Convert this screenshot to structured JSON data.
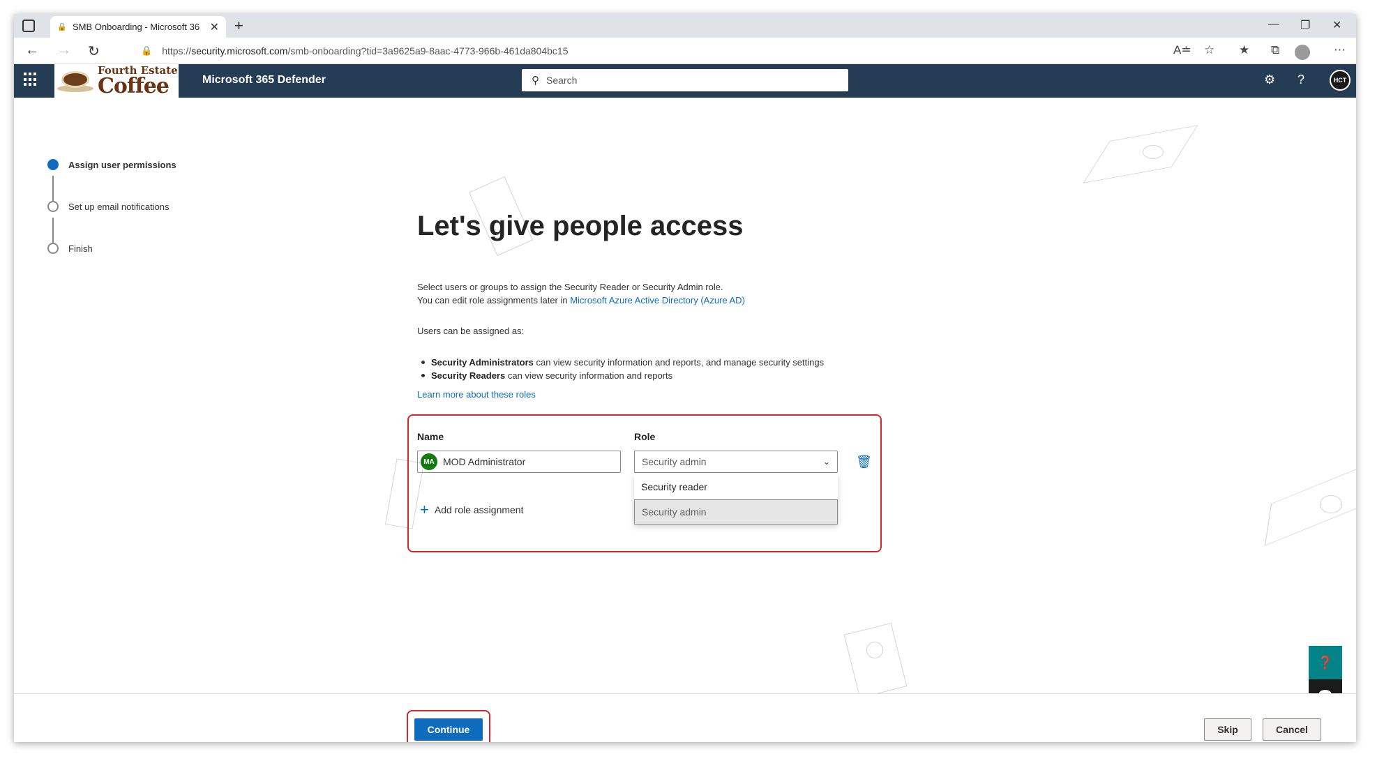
{
  "browser": {
    "tab_title": "SMB Onboarding - Microsoft 36",
    "url_prefix": "https://",
    "url_domain": "security.microsoft.com",
    "url_path": "/smb-onboarding?tid=3a9625a9-8aac-4773-966b-461da804bc15"
  },
  "header": {
    "logo_top": "Fourth Estate",
    "logo_bottom": "Coffee",
    "app_name": "Microsoft 365 Defender",
    "search_placeholder": "Search",
    "avatar_initials": "HCT"
  },
  "steps": [
    {
      "label": "Assign user permissions",
      "state": "active"
    },
    {
      "label": "Set up email notifications",
      "state": "pending"
    },
    {
      "label": "Finish",
      "state": "pending"
    }
  ],
  "main": {
    "title": "Let's give people access",
    "intro_line1": "Select users or groups to assign the Security Reader or Security Admin role.",
    "intro_line2": "You can edit role assignments later in ",
    "intro_link": "Microsoft Azure Active Directory (Azure AD)",
    "assign_intro": "Users can be assigned as:",
    "bullet1_bold": "Security Administrators",
    "bullet1_rest": " can view security information and reports, and manage security settings",
    "bullet2_bold": "Security Readers",
    "bullet2_rest": " can view security information and reports",
    "learn_more": "Learn more about these roles"
  },
  "assignment": {
    "name_label": "Name",
    "role_label": "Role",
    "user_initials": "MA",
    "user_name": "MOD Administrator",
    "role_value": "Security admin",
    "role_options": [
      "Security reader",
      "Security admin"
    ],
    "add_role": "Add role assignment"
  },
  "footer": {
    "continue": "Continue",
    "skip": "Skip",
    "cancel": "Cancel"
  },
  "colors": {
    "accent": "#0f6cbd",
    "header_bg": "#253c55",
    "highlight_red": "#d9262e"
  }
}
